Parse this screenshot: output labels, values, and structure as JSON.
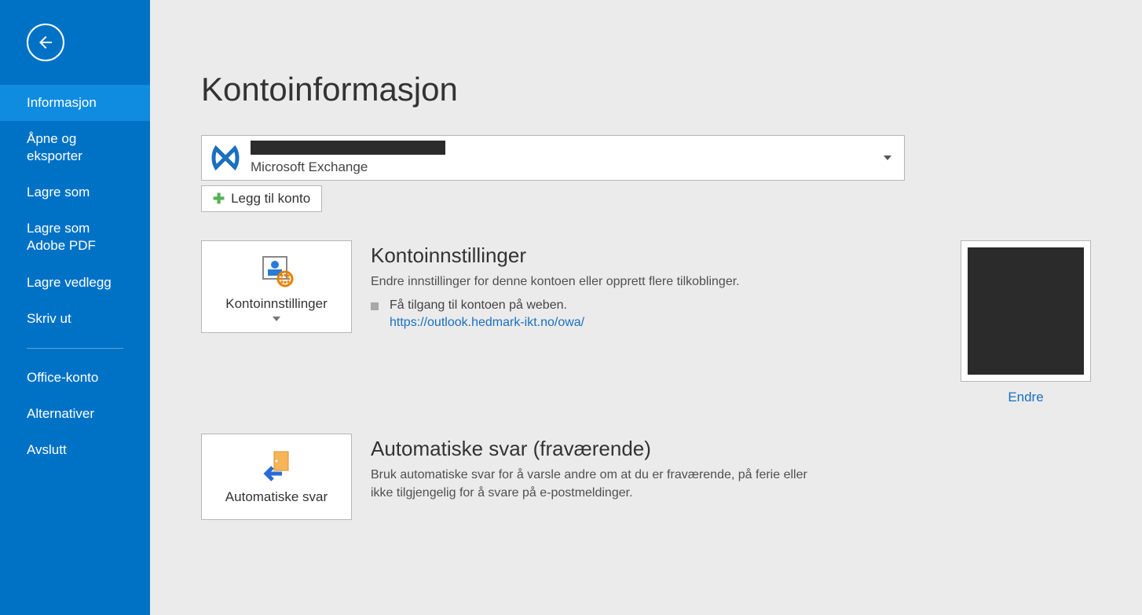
{
  "sidebar": {
    "items": [
      {
        "label": "Informasjon"
      },
      {
        "label": "Åpne og eksporter"
      },
      {
        "label": "Lagre som"
      },
      {
        "label": "Lagre som Adobe PDF"
      },
      {
        "label": "Lagre vedlegg"
      },
      {
        "label": "Skriv ut"
      },
      {
        "label": "Office-konto"
      },
      {
        "label": "Alternativer"
      },
      {
        "label": "Avslutt"
      }
    ]
  },
  "page": {
    "title": "Kontoinformasjon"
  },
  "account_selector": {
    "type_label": "Microsoft Exchange"
  },
  "add_account": {
    "label": "Legg til konto"
  },
  "account_settings": {
    "tile_label": "Kontoinnstillinger",
    "heading": "Kontoinnstillinger",
    "desc": "Endre innstillinger for denne kontoen eller opprett flere tilkoblinger.",
    "bullet": "Få tilgang til kontoen på weben.",
    "link": "https://outlook.hedmark-ikt.no/owa/"
  },
  "profile": {
    "change_label": "Endre"
  },
  "auto_reply": {
    "tile_label": "Automatiske svar",
    "heading": "Automatiske svar (fraværende)",
    "desc": "Bruk automatiske svar for å varsle andre om at du er fraværende, på ferie eller ikke tilgjengelig for å svare på e-postmeldinger."
  }
}
